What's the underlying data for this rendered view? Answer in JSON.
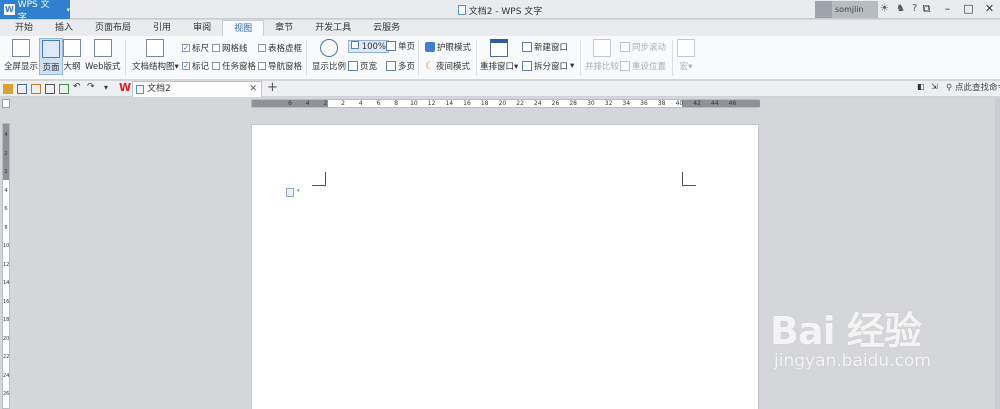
{
  "app": {
    "name": "WPS 文字",
    "window_title": "文档2 - WPS 文字",
    "user": "somjlin"
  },
  "menu_tabs": [
    "开始",
    "插入",
    "页面布局",
    "引用",
    "审阅",
    "视图",
    "章节",
    "开发工具",
    "云服务"
  ],
  "active_tab": "视图",
  "ribbon": {
    "fullscreen": "全屏显示",
    "page": "页面",
    "outline": "大纲",
    "web": "Web版式",
    "doc_structure": "文档结构图",
    "ruler": "标尺",
    "gridlines": "网格线",
    "table_dashed": "表格虚框",
    "markers": "标记",
    "task_pane": "任务窗格",
    "nav_pane": "导航窗格",
    "zoom": "显示比例",
    "zoom_100": "100%",
    "single_page": "单页",
    "page_width": "页宽",
    "multi_page": "多页",
    "eye_mode": "护眼模式",
    "night_mode": "夜间模式",
    "arrange_windows": "重排窗口",
    "new_window": "新建窗口",
    "split_window": "拆分窗口",
    "side_by_side": "并排比较",
    "sync_scroll": "同步滚动",
    "reset_position": "重设位置",
    "macro": "宏"
  },
  "doc_tab": "文档2",
  "find_placeholder": "点此查找命令",
  "ruler_ticks_h": [
    "6",
    "4",
    "2",
    "2",
    "4",
    "6",
    "8",
    "10",
    "12",
    "14",
    "16",
    "18",
    "20",
    "22",
    "24",
    "26",
    "28",
    "30",
    "32",
    "34",
    "36",
    "38",
    "40",
    "42",
    "44",
    "46"
  ],
  "ruler_ticks_v": [
    "4",
    "2",
    "2",
    "4",
    "6",
    "8",
    "10",
    "12",
    "14",
    "16",
    "18",
    "20",
    "22",
    "24",
    "26"
  ],
  "watermark": {
    "brand": "Bai 经验",
    "url": "jingyan.baidu.com"
  }
}
